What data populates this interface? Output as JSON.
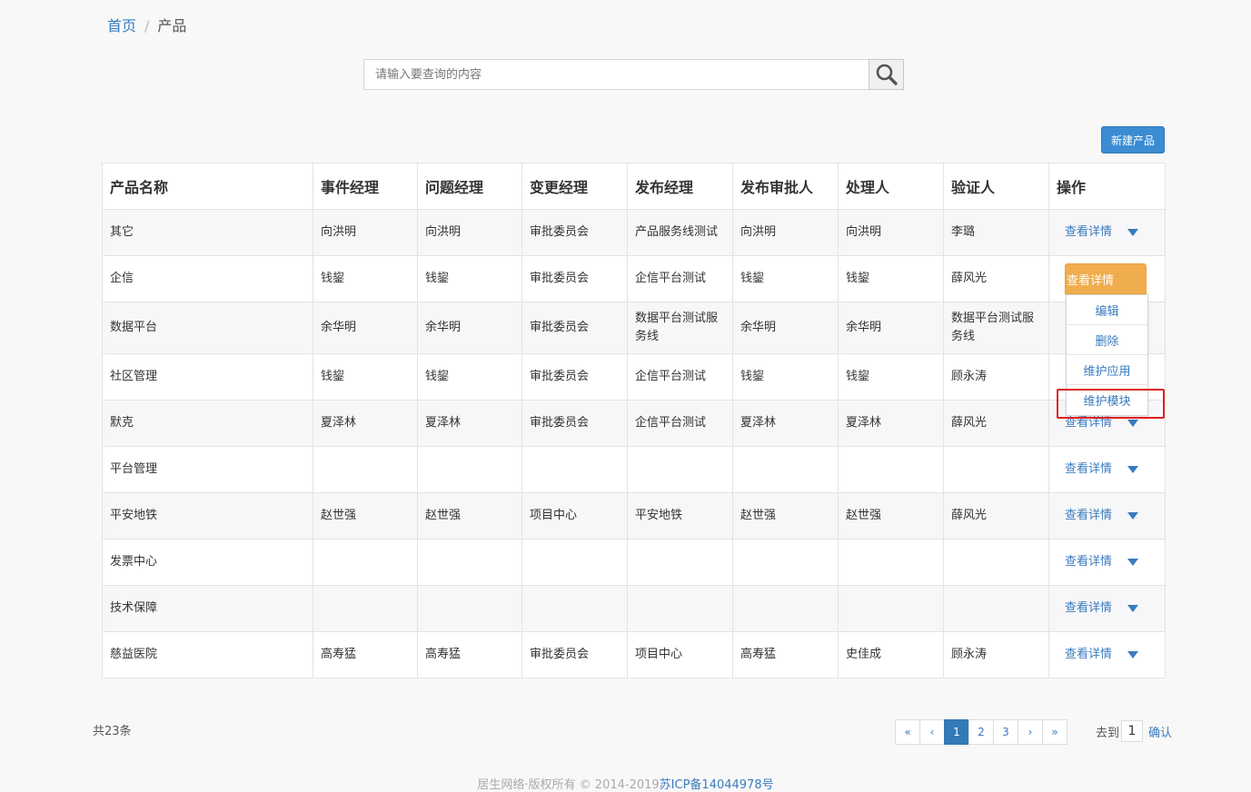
{
  "breadcrumb": {
    "home": "首页",
    "separator": "/",
    "current": "产品"
  },
  "search": {
    "placeholder": "请输入要查询的内容",
    "icon": "search-icon"
  },
  "toolbar": {
    "new_label": "新建产品"
  },
  "table": {
    "headers": [
      "产品名称",
      "事件经理",
      "问题经理",
      "变更经理",
      "发布经理",
      "发布审批人",
      "处理人",
      "验证人",
      "操作"
    ],
    "detail_label": "查看详情",
    "rows": [
      [
        "其它",
        "向洪明",
        "向洪明",
        "审批委员会",
        "产品服务线测试",
        "向洪明",
        "向洪明",
        "李璐"
      ],
      [
        "企信",
        "钱鋆",
        "钱鋆",
        "审批委员会",
        "企信平台测试",
        "钱鋆",
        "钱鋆",
        "薛风光"
      ],
      [
        "数据平台",
        "余华明",
        "余华明",
        "审批委员会",
        "数据平台测试服务线",
        "余华明",
        "余华明",
        "数据平台测试服务线"
      ],
      [
        "社区管理",
        "钱鋆",
        "钱鋆",
        "审批委员会",
        "企信平台测试",
        "钱鋆",
        "钱鋆",
        "顾永涛"
      ],
      [
        "默克",
        "夏泽林",
        "夏泽林",
        "审批委员会",
        "企信平台测试",
        "夏泽林",
        "夏泽林",
        "薛风光"
      ],
      [
        "平台管理",
        "",
        "",
        "",
        "",
        "",
        "",
        ""
      ],
      [
        "平安地铁",
        "赵世强",
        "赵世强",
        "项目中心",
        "平安地铁",
        "赵世强",
        "赵世强",
        "薛风光"
      ],
      [
        "发票中心",
        "",
        "",
        "",
        "",
        "",
        "",
        ""
      ],
      [
        "技术保障",
        "",
        "",
        "",
        "",
        "",
        "",
        ""
      ],
      [
        "慈益医院",
        "高寿猛",
        "高寿猛",
        "审批委员会",
        "项目中心",
        "高寿猛",
        "史佳成",
        "顾永涛"
      ]
    ]
  },
  "dropdown": {
    "button_label": "查看详情",
    "items": [
      "编辑",
      "删除",
      "维护应用",
      "维护模块"
    ],
    "highlight_color": "#e02020"
  },
  "pagination": {
    "total": "共23条",
    "first": "«",
    "prev": "‹",
    "pages": [
      "1",
      "2",
      "3"
    ],
    "current": "1",
    "next": "›",
    "last": "»",
    "goto_label": "去到",
    "goto_value": "1",
    "confirm_label": "确认"
  },
  "footer": {
    "copyright": "居生网络·版权所有 © 2014-2019",
    "icp": "苏ICP备14044978号"
  },
  "colors": {
    "accent": "#3a7bbf",
    "primary_button": "#3b8cd3",
    "warning_button": "#f0ad4e"
  }
}
